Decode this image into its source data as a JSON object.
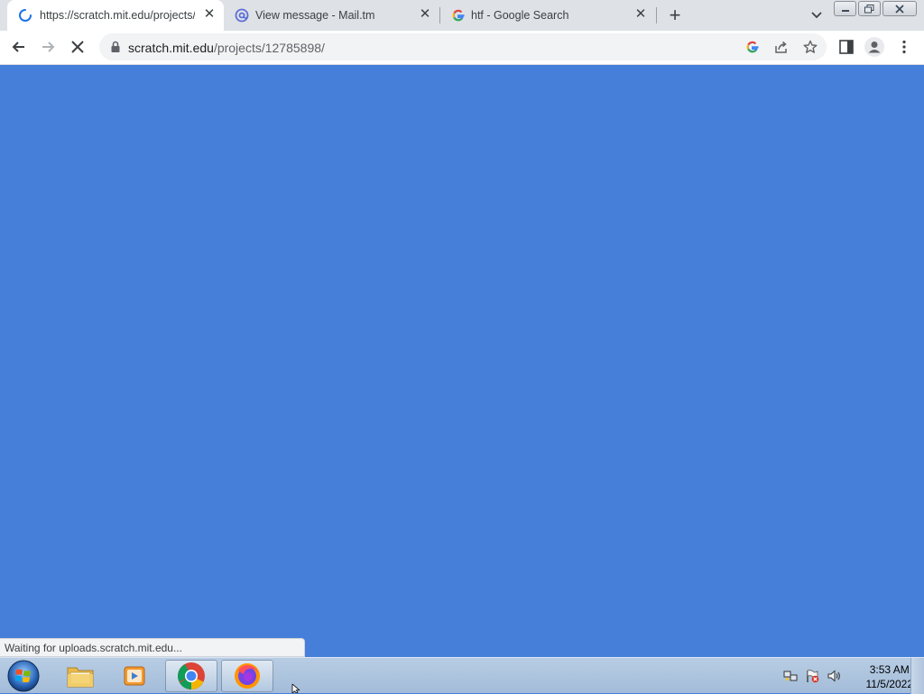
{
  "tabs": [
    {
      "title": "https://scratch.mit.edu/projects/",
      "favicon": "loading-spinner-icon",
      "active": true
    },
    {
      "title": "View message - Mail.tm",
      "favicon": "mailtm-icon",
      "active": false
    },
    {
      "title": "htf - Google Search",
      "favicon": "google-icon",
      "active": false
    }
  ],
  "omnibox": {
    "host": "scratch.mit.edu",
    "path": "/projects/12785898/"
  },
  "status_bubble": "Waiting for uploads.scratch.mit.edu...",
  "page": {
    "background": "#457fd9"
  },
  "taskbar": {
    "apps": [
      "windows-explorer",
      "media-player",
      "google-chrome",
      "firefox"
    ]
  },
  "clock": {
    "time": "3:53 AM",
    "date": "11/5/2022"
  }
}
